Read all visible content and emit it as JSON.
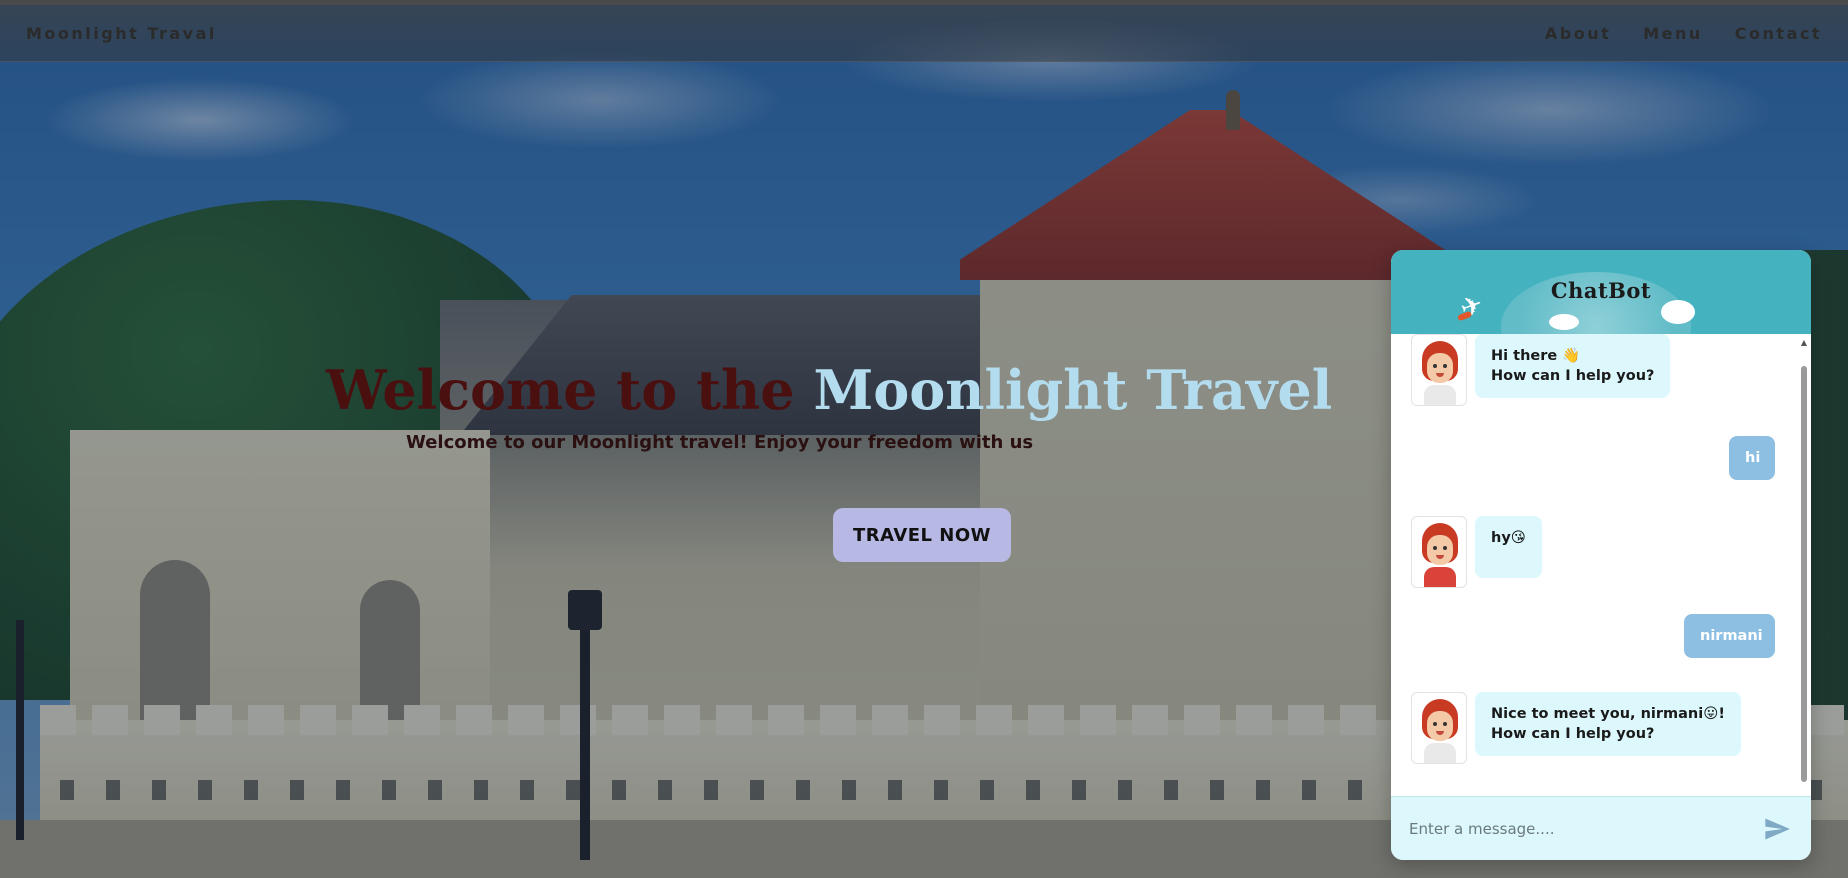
{
  "navbar": {
    "brand": "Moonlight Traval",
    "links": [
      "About",
      "Menu",
      "Contact"
    ]
  },
  "hero": {
    "title_part1": "Welcome to the ",
    "title_part2": "Moonlight Travel",
    "subtitle": "Welcome to our Moonlight travel! Enjoy your freedom with us",
    "cta_label": "TRAVEL NOW"
  },
  "chatbot": {
    "title": "ChatBot",
    "messages": [
      {
        "from": "bot",
        "text": "Hi there 👋\nHow can I help you?"
      },
      {
        "from": "user",
        "text": "hi"
      },
      {
        "from": "bot",
        "text": "hy😘"
      },
      {
        "from": "user",
        "text": "nirmani"
      },
      {
        "from": "bot",
        "text": "Nice to meet you, nirmani😛!\nHow can I help you?"
      }
    ],
    "input_placeholder": "Enter a message....",
    "send_icon": "send-icon"
  },
  "colors": {
    "chat_header": "#45b3bf",
    "bot_bubble": "#dcf8fc",
    "user_bubble": "#8dbfe3",
    "cta_button": "#b7b8e3",
    "title_dark": "#4a1010",
    "title_light": "#b3dcef"
  }
}
